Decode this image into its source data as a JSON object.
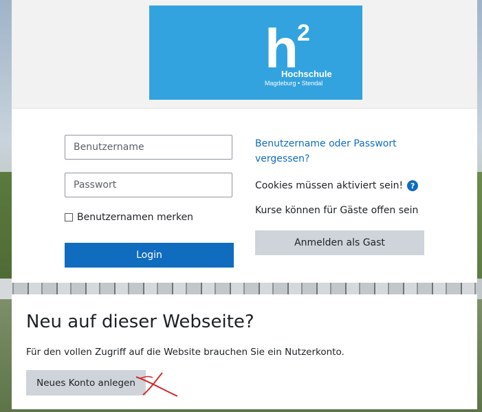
{
  "logo": {
    "superscript": "2",
    "letter": "h",
    "name": "Hochschule",
    "sub": "Magdeburg • Stendal",
    "color": "#33a3df"
  },
  "login": {
    "username_placeholder": "Benutzername",
    "password_placeholder": "Passwort",
    "remember_label": "Benutzernamen merken",
    "login_button": "Login",
    "forgot_link": "Benutzername oder Passwort vergessen?",
    "cookies_text": "Cookies müssen aktiviert sein!",
    "help_icon": "question-circle-icon",
    "guests_text": "Kurse können für Gäste offen sein",
    "guest_button": "Anmelden als Gast",
    "accent": "#0f6cbf"
  },
  "signup": {
    "title": "Neu auf dieser Webseite?",
    "text": "Für den vollen Zugriff auf die Website brauchen Sie ein Nutzerkonto.",
    "button": "Neues Konto anlegen",
    "annotation": "red-scribble-cross"
  }
}
